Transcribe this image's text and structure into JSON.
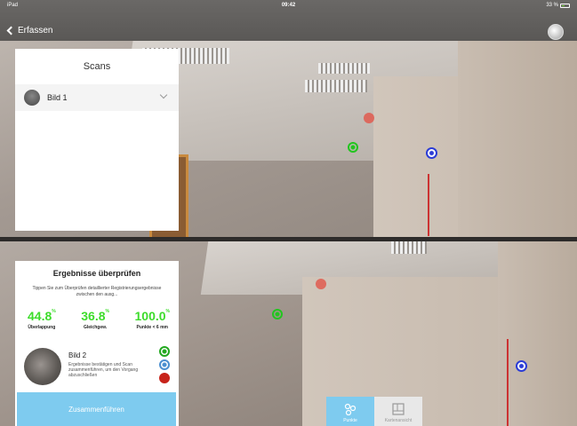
{
  "statusbar": {
    "device": "iPad",
    "time": "09:42",
    "battery": "33 %"
  },
  "nav": {
    "back_label": "Erfassen"
  },
  "scans": {
    "title": "Scans",
    "items": [
      {
        "label": "Bild 1"
      }
    ]
  },
  "results": {
    "title": "Ergebnisse überprüfen",
    "description": "Tippen Sie zum Überprüfen detaillierter Registrierungsergebnisse zwischen den ausg...",
    "stats": [
      {
        "value": "44.8",
        "unit": "%",
        "label": "Überlappung"
      },
      {
        "value": "36.8",
        "unit": "%",
        "label": "Gleichgew."
      },
      {
        "value": "100.0",
        "unit": "%",
        "label": "Punkte < 6 mm"
      }
    ],
    "scan_title": "Bild 2",
    "scan_desc": "Ergebnisse bestätigen und Scan zusammenführen, um den Vorgang abzuschließen",
    "merge_label": "Zusammenführen"
  },
  "view_toggle": {
    "points_label": "Punkte",
    "map_label": "Kartenansicht"
  },
  "colors": {
    "accent": "#7ecbef",
    "stat_green": "#3ddc2b",
    "target_green": "#22c51f",
    "target_blue": "#2b3cd6",
    "target_red": "#c7231a"
  }
}
